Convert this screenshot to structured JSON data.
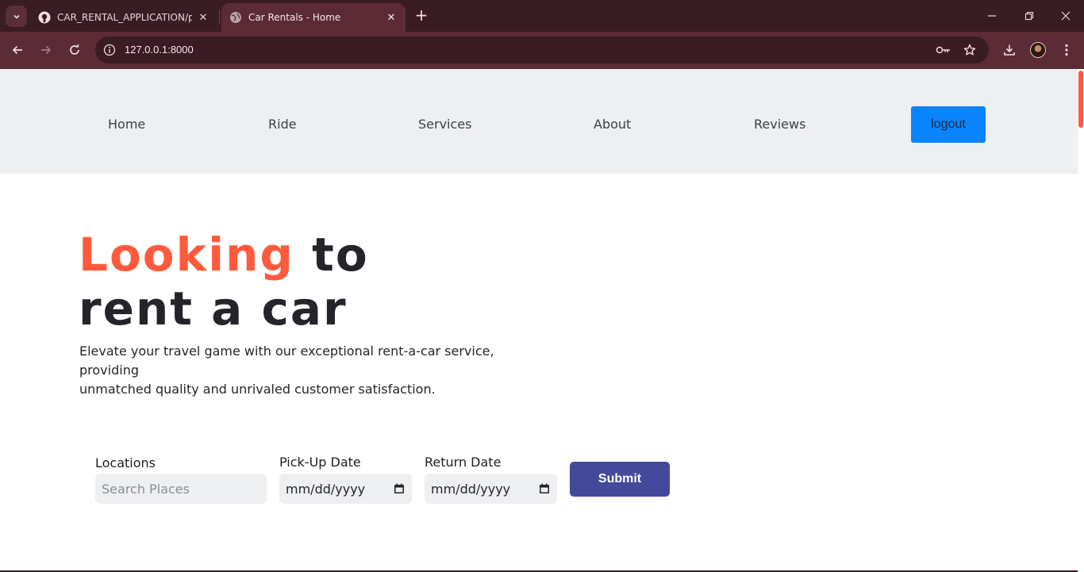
{
  "browser": {
    "tabs": [
      {
        "title": "CAR_RENTAL_APPLICATION/ppr",
        "icon": "github-icon"
      },
      {
        "title": "Car Rentals - Home",
        "icon": "globe-icon"
      }
    ],
    "close_glyph": "✕",
    "new_tab_glyph": "+",
    "url": "127.0.0.1:8000",
    "colors": {
      "tabbar": "#3a1c24",
      "toolbar": "#5b2b36"
    }
  },
  "page": {
    "nav": {
      "links": [
        "Home",
        "Ride",
        "Services",
        "About",
        "Reviews"
      ],
      "logout_label": "logout"
    },
    "hero": {
      "title_accent": "Looking",
      "title_rest_line1": " to",
      "title_line2": "rent a car",
      "description_line1": "Elevate your travel game with our exceptional rent-a-car service, providing",
      "description_line2": "unmatched quality and unrivaled customer satisfaction."
    },
    "form": {
      "location_label": "Locations",
      "location_placeholder": "Search Places",
      "pickup_label": "Pick-Up Date",
      "pickup_value": "mm/dd/yyyy",
      "return_label": "Return Date",
      "return_value": "mm/dd/yyyy",
      "submit_label": "Submit"
    },
    "colors": {
      "accent": "#ff5a3c",
      "logout": "#0a84ff",
      "submit": "#434a9c",
      "navbar_bg": "#eeeff1"
    }
  }
}
